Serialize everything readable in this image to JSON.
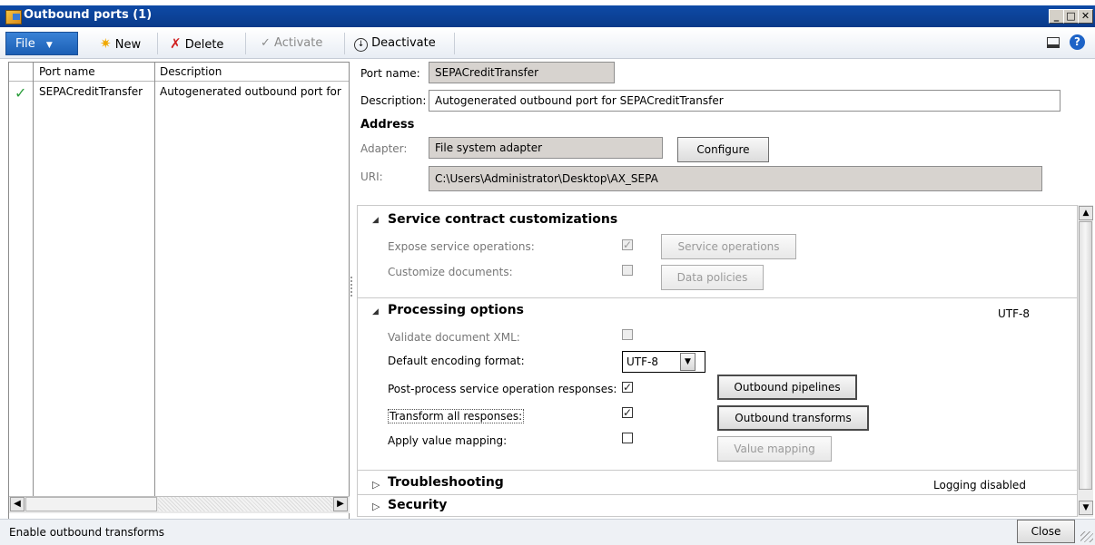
{
  "window": {
    "title": "Outbound ports (1)",
    "min": "_",
    "max": "□",
    "close": "✕"
  },
  "colors": {
    "titlebar": "#0e4aa6",
    "file_button": "#1b5fb5",
    "readonly_field": "#d7d3cf",
    "selection_check": "#2a9d3a"
  },
  "toolbar": {
    "file_label": "File",
    "new_label": "New",
    "delete_label": "Delete",
    "activate_label": "Activate",
    "deactivate_label": "Deactivate"
  },
  "list": {
    "columns": [
      "Port name",
      "Description"
    ],
    "rows": [
      {
        "port_name": "SEPACreditTransfer",
        "description": "Autogenerated outbound port for",
        "active_mark": "✓"
      }
    ]
  },
  "form": {
    "port_name_label": "Port name:",
    "port_name_value": "SEPACreditTransfer",
    "description_label": "Description:",
    "description_value": "Autogenerated outbound port for SEPACreditTransfer",
    "address_heading": "Address",
    "adapter_label": "Adapter:",
    "adapter_value": "File system adapter",
    "configure_label": "Configure",
    "uri_label": "URI:",
    "uri_value": "C:\\Users\\Administrator\\Desktop\\AX_SEPA"
  },
  "service_contract": {
    "heading": "Service contract customizations",
    "expose_label": "Expose service operations:",
    "expose_checked": true,
    "service_operations_label": "Service operations",
    "customize_label": "Customize documents:",
    "customize_checked": false,
    "data_policies_label": "Data policies"
  },
  "processing": {
    "heading": "Processing options",
    "summary": "UTF-8",
    "validate_label": "Validate document XML:",
    "validate_checked": false,
    "encoding_label": "Default encoding format:",
    "encoding_value": "UTF-8",
    "postprocess_label": "Post-process service operation responses:",
    "postprocess_checked": true,
    "outbound_pipelines_label": "Outbound pipelines",
    "transform_label": "Transform all responses:",
    "transform_checked": true,
    "outbound_transforms_label": "Outbound transforms",
    "value_mapping_label": "Apply value mapping:",
    "value_mapping_checked": false,
    "value_mapping_button": "Value mapping"
  },
  "troubleshooting": {
    "heading": "Troubleshooting",
    "summary": "Logging disabled"
  },
  "security": {
    "heading": "Security"
  },
  "status": {
    "text": "Enable outbound transforms",
    "close_label": "Close"
  }
}
